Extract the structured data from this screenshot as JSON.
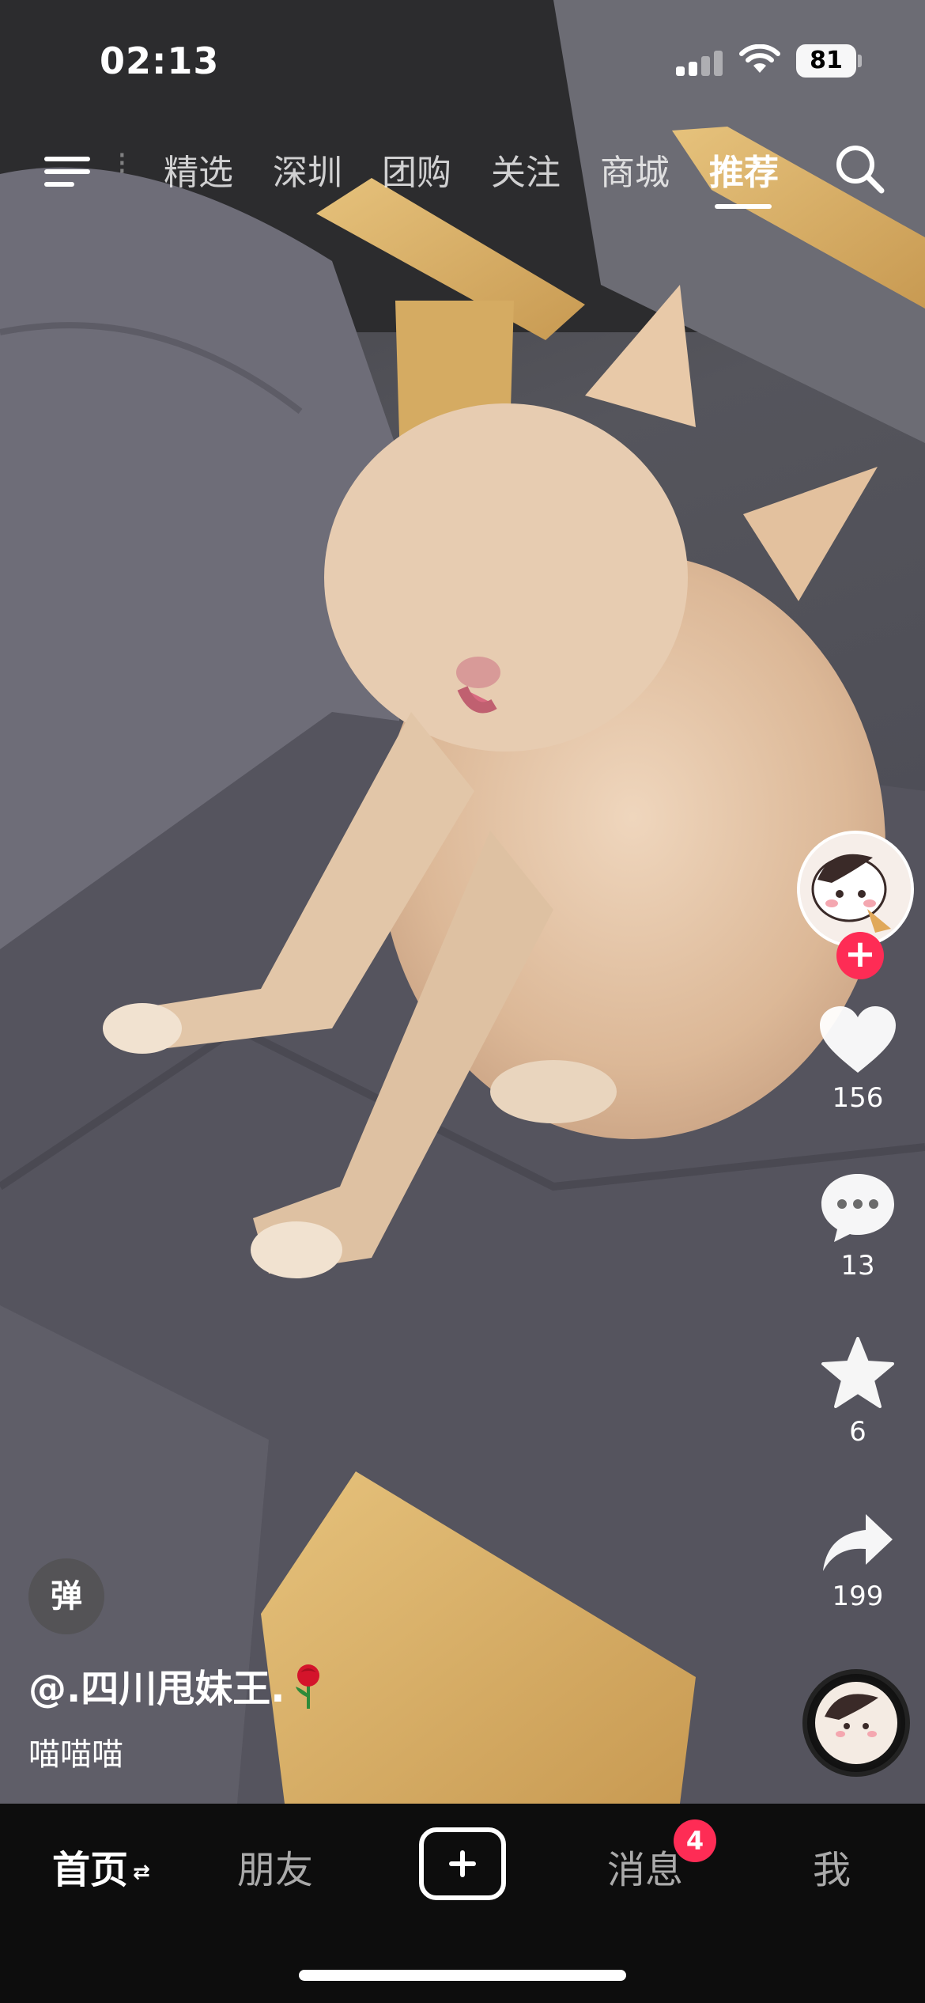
{
  "status_bar": {
    "time": "02:13",
    "battery": "81"
  },
  "top_nav": {
    "tabs": [
      {
        "label": "精选"
      },
      {
        "label": "深圳"
      },
      {
        "label": "团购"
      },
      {
        "label": "关注"
      },
      {
        "label": "商城"
      },
      {
        "label": "推荐",
        "active": true
      }
    ]
  },
  "video": {
    "subject": "cat",
    "author": "@.四川甩妹王.",
    "caption": "喵喵喵"
  },
  "actions": {
    "likes": "156",
    "comments": "13",
    "favorites": "6",
    "shares": "199"
  },
  "danmu_label": "弹",
  "bottom_nav": {
    "home": "首页",
    "friends": "朋友",
    "messages": "消息",
    "messages_badge": "4",
    "me": "我"
  },
  "colors": {
    "accent": "#fe2c55",
    "tab_bar": "#0d0d0d"
  }
}
